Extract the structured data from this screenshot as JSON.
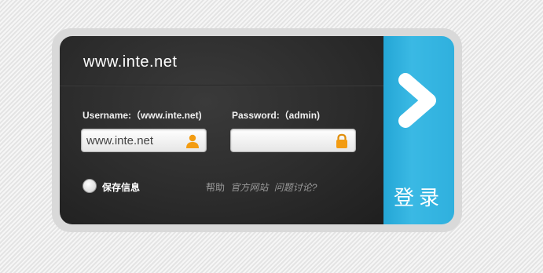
{
  "site_title": "www.inte.net",
  "username": {
    "label": "Username:（www.inte.net)",
    "value": "www.inte.net",
    "icon": "user-icon"
  },
  "password": {
    "label": "Password:（admin)",
    "value": "",
    "icon": "lock-icon"
  },
  "remember": {
    "label": "保存信息",
    "checked": false
  },
  "links": {
    "help": "帮助",
    "official_site": "官方网站",
    "discuss": "问题讨论?"
  },
  "login_button": {
    "label": "登录",
    "icon": "chevron-right-icon"
  },
  "colors": {
    "accent": "#2fb0de",
    "panel": "#2c2c2c",
    "icon_orange": "#f39c12"
  }
}
